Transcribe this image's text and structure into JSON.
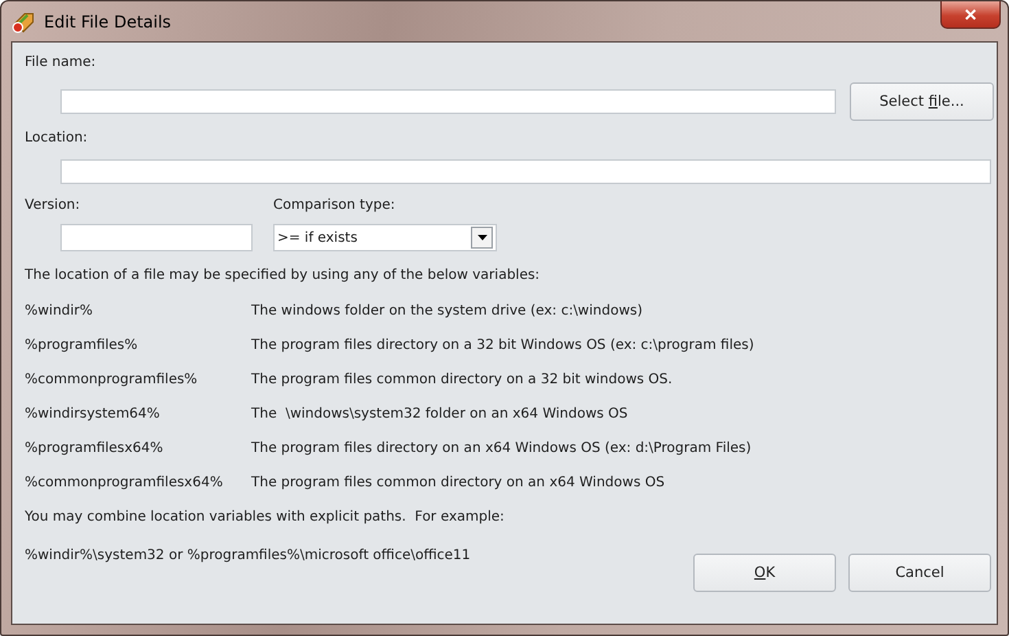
{
  "window": {
    "title": "Edit File Details",
    "close": "✕"
  },
  "file_name": {
    "label": "File name:"
  },
  "select_button": {
    "before": "Select ",
    "key": "f",
    "after": "ile..."
  },
  "location": {
    "label": "Location:"
  },
  "version": {
    "label": "Version:"
  },
  "comparison": {
    "label": "Comparison type:",
    "value": ">= if exists"
  },
  "intro": "The location of a file may be specified by using any of the below variables:",
  "variables": [
    {
      "name": "%windir%",
      "description": "The windows folder on the system drive (ex: c:\\windows)"
    },
    {
      "name": "%programfiles%",
      "description": "The program files directory on a 32 bit Windows OS (ex: c:\\program files)"
    },
    {
      "name": "%commonprogramfiles%",
      "description": "The program files common directory on a 32 bit windows OS."
    },
    {
      "name": "%windirsystem64%",
      "description": "The  \\windows\\system32 folder on an x64 Windows OS"
    },
    {
      "name": "%programfilesx64%",
      "description": "The program files directory on an x64 Windows OS (ex: d:\\Program Files)"
    },
    {
      "name": "%commonprogramfilesx64%",
      "description": "The program files common directory on an x64 Windows OS"
    }
  ],
  "combine_note": "You may combine location variables with explicit paths.  For example:",
  "example": "%windir%\\system32 or %programfiles%\\microsoft office\\office11",
  "ok_button": {
    "key": "O",
    "after": "K"
  },
  "cancel_button": {
    "before": "Cancel"
  }
}
